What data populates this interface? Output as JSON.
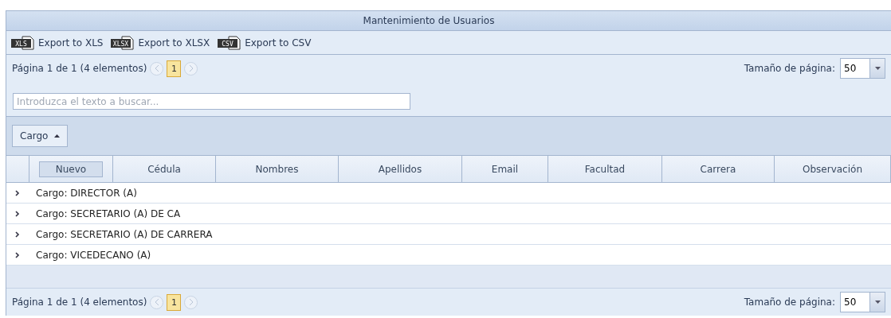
{
  "title": "Mantenimiento de Usuarios",
  "exports": [
    {
      "label": "Export to XLS",
      "format": "XLS"
    },
    {
      "label": "Export to XLSX",
      "format": "XLSX"
    },
    {
      "label": "Export to CSV",
      "format": "CSV"
    }
  ],
  "pager_top": {
    "summary": "Página 1 de 1 (4 elementos)",
    "pages": [
      {
        "label": "1",
        "selected": true
      }
    ],
    "prev_disabled": true,
    "next_disabled": true,
    "size_label": "Tamaño de página:",
    "size_value": "50"
  },
  "search": {
    "placeholder": "Introduzca el texto a buscar..."
  },
  "group_panel": [
    {
      "label": "Cargo"
    }
  ],
  "columns": [
    {
      "kind": "command",
      "label": "Nuevo"
    },
    {
      "kind": "data",
      "label": "Cédula"
    },
    {
      "kind": "data",
      "label": "Nombres"
    },
    {
      "kind": "data",
      "label": "Apellidos"
    },
    {
      "kind": "data",
      "label": "Email"
    },
    {
      "kind": "data",
      "label": "Facultad"
    },
    {
      "kind": "data",
      "label": "Carrera"
    },
    {
      "kind": "data",
      "label": "Observación"
    }
  ],
  "group_rows": [
    {
      "label": "Cargo: DIRECTOR (A)",
      "expanded": false
    },
    {
      "label": "Cargo: SECRETARIO (A) DE CA",
      "expanded": false
    },
    {
      "label": "Cargo: SECRETARIO (A) DE CARRERA",
      "expanded": false
    },
    {
      "label": "Cargo: VICEDECANO (A)",
      "expanded": false
    }
  ],
  "pager_bottom": {
    "summary": "Página 1 de 1 (4 elementos)",
    "pages": [
      {
        "label": "1",
        "selected": true
      }
    ],
    "prev_disabled": true,
    "next_disabled": true,
    "size_label": "Tamaño de página:",
    "size_value": "50"
  }
}
